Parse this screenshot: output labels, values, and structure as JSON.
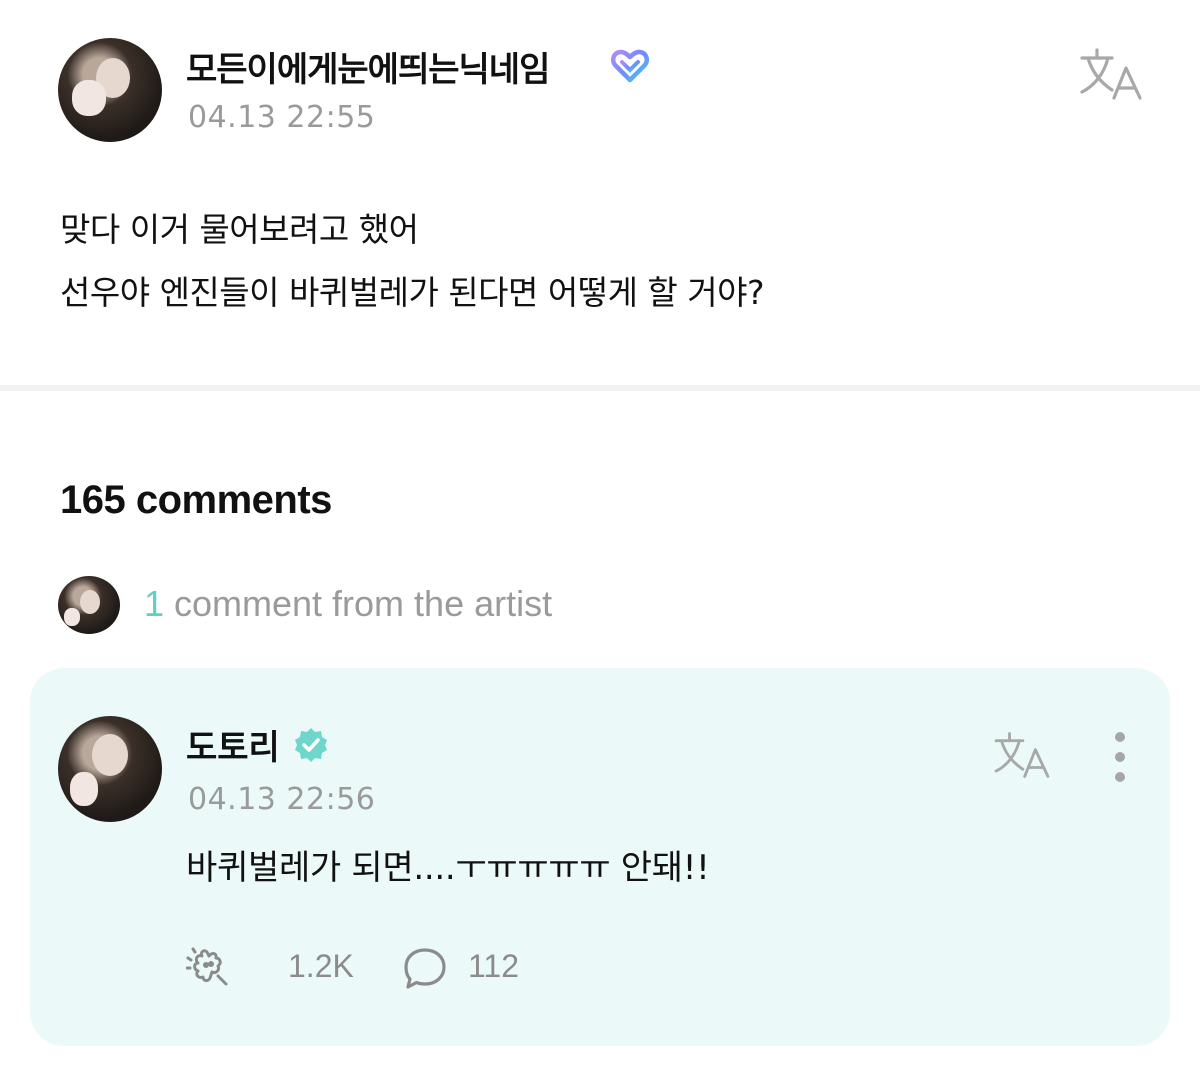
{
  "post": {
    "author": "모든이에게눈에띄는닉네임",
    "time": "04.13 22:55",
    "body_lines": [
      "맞다 이거 물어보려고 했어",
      "선우야 엔진들이 바퀴벌레가 된다면 어떻게 할 거야?"
    ],
    "translate_icon": "translate-icon",
    "badge_icon": "heart-badge-icon"
  },
  "comments": {
    "count_label": "165 comments",
    "artist_count": "1",
    "artist_label": "comment from the artist"
  },
  "artist_comment": {
    "author": "도토리",
    "time": "04.13 22:56",
    "text": "바퀴벌레가 되면....ㅜㅠㅠㅠㅠ 안돼!!",
    "likes": "1.2K",
    "replies": "112",
    "verified_icon": "verified-badge-icon"
  },
  "colors": {
    "accent": "#5fd0c8",
    "card_bg": "#ebfaf8",
    "muted_text": "#9a9a9a"
  }
}
